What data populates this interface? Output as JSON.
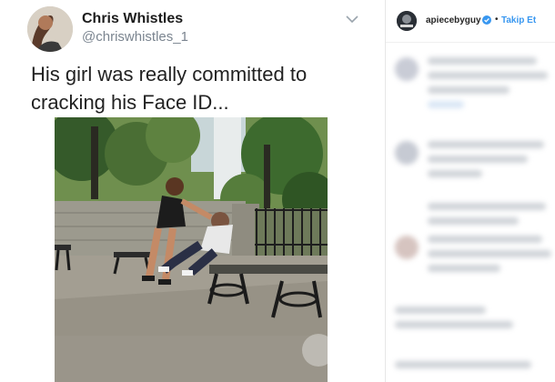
{
  "tweet": {
    "author_name": "Chris Whistles",
    "author_handle": "@chriswhistles_1",
    "text": "His girl was really committed to cracking his Face ID..."
  },
  "instagram": {
    "username": "apiecebyguy",
    "separator": "•",
    "follow_label": "Takip Et"
  },
  "colors": {
    "follow_blue": "#3897f0",
    "verified_blue": "#3897f0"
  }
}
